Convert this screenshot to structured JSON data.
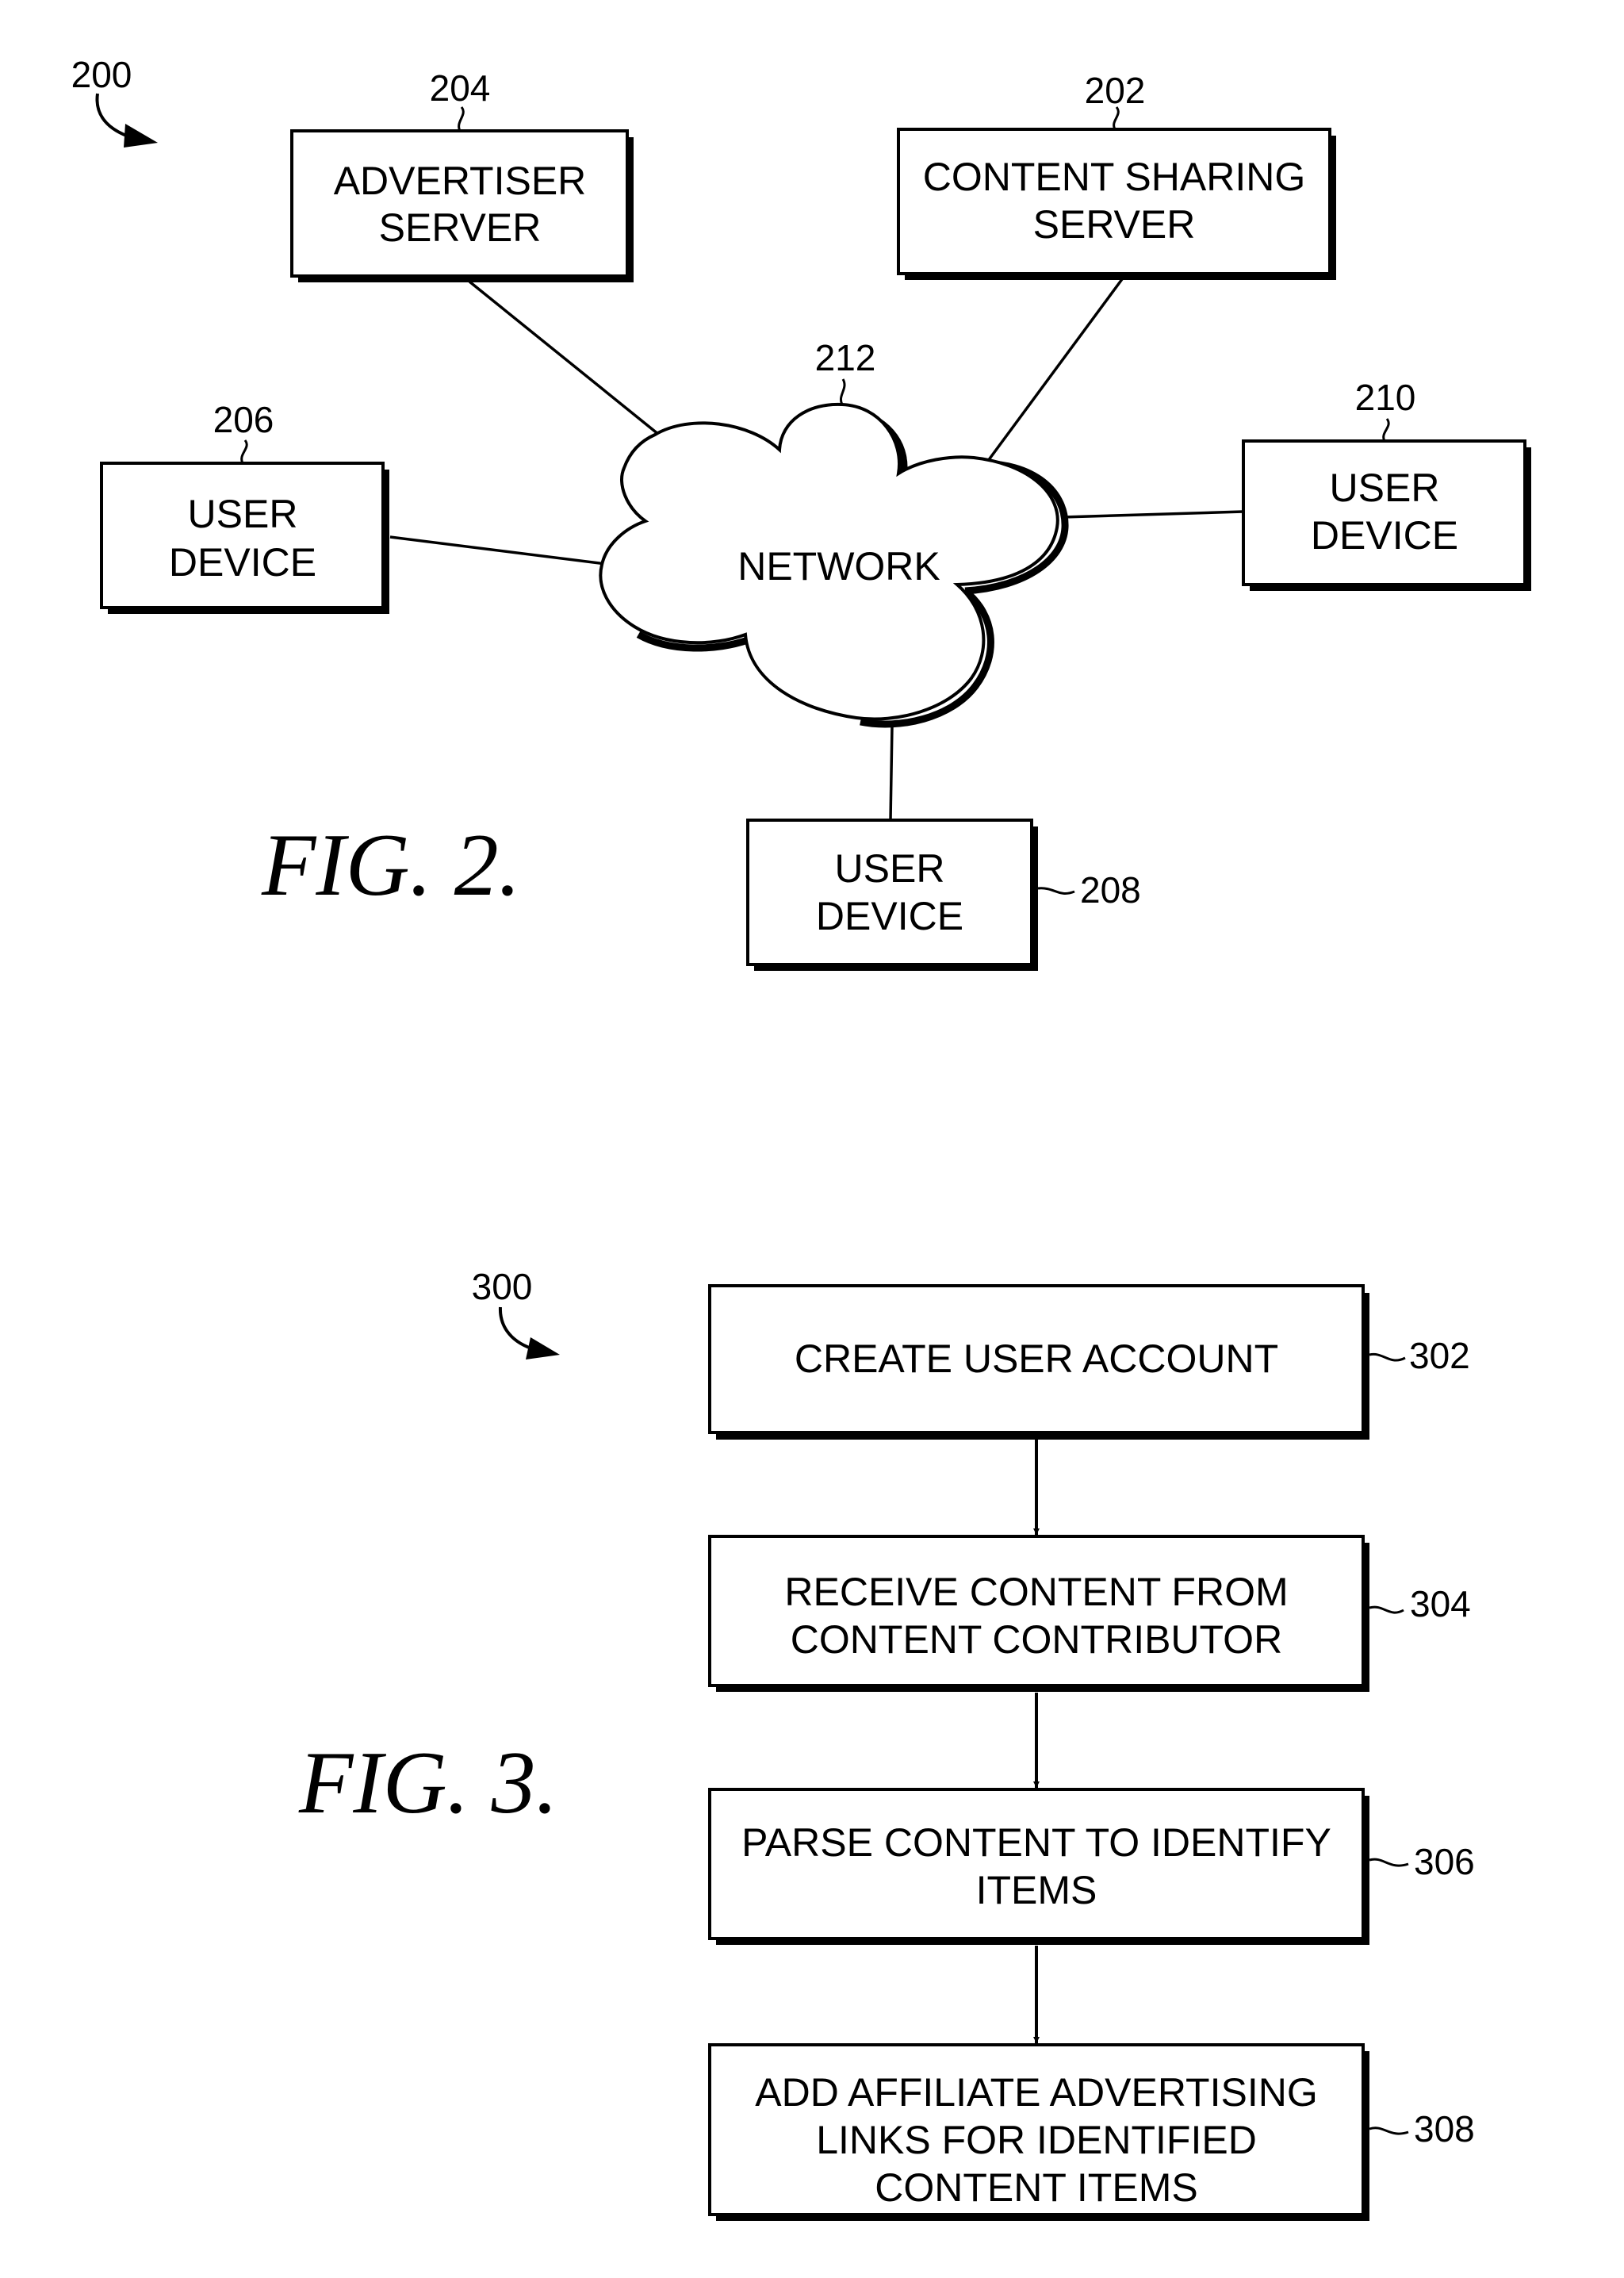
{
  "colors": {
    "ink": "#000000",
    "paper": "#ffffff"
  },
  "fig2": {
    "ref": "200",
    "caption": "FIG. 2.",
    "network": {
      "ref": "212",
      "label": "NETWORK"
    },
    "nodes": [
      {
        "id": "advertiser-server",
        "ref": "204",
        "lines": [
          "ADVERTISER",
          "SERVER"
        ]
      },
      {
        "id": "content-sharing-server",
        "ref": "202",
        "lines": [
          "CONTENT SHARING",
          "SERVER"
        ]
      },
      {
        "id": "user-device-206",
        "ref": "206",
        "lines": [
          "USER",
          "DEVICE"
        ]
      },
      {
        "id": "user-device-210",
        "ref": "210",
        "lines": [
          "USER",
          "DEVICE"
        ]
      },
      {
        "id": "user-device-208",
        "ref": "208",
        "lines": [
          "USER",
          "DEVICE"
        ]
      }
    ]
  },
  "fig3": {
    "ref": "300",
    "caption": "FIG. 3.",
    "steps": [
      {
        "ref": "302",
        "lines": [
          "CREATE USER ACCOUNT"
        ]
      },
      {
        "ref": "304",
        "lines": [
          "RECEIVE CONTENT FROM",
          "CONTENT CONTRIBUTOR"
        ]
      },
      {
        "ref": "306",
        "lines": [
          "PARSE CONTENT TO IDENTIFY",
          "ITEMS"
        ]
      },
      {
        "ref": "308",
        "lines": [
          "ADD AFFILIATE ADVERTISING",
          "LINKS FOR IDENTIFIED",
          "CONTENT ITEMS"
        ]
      }
    ]
  }
}
